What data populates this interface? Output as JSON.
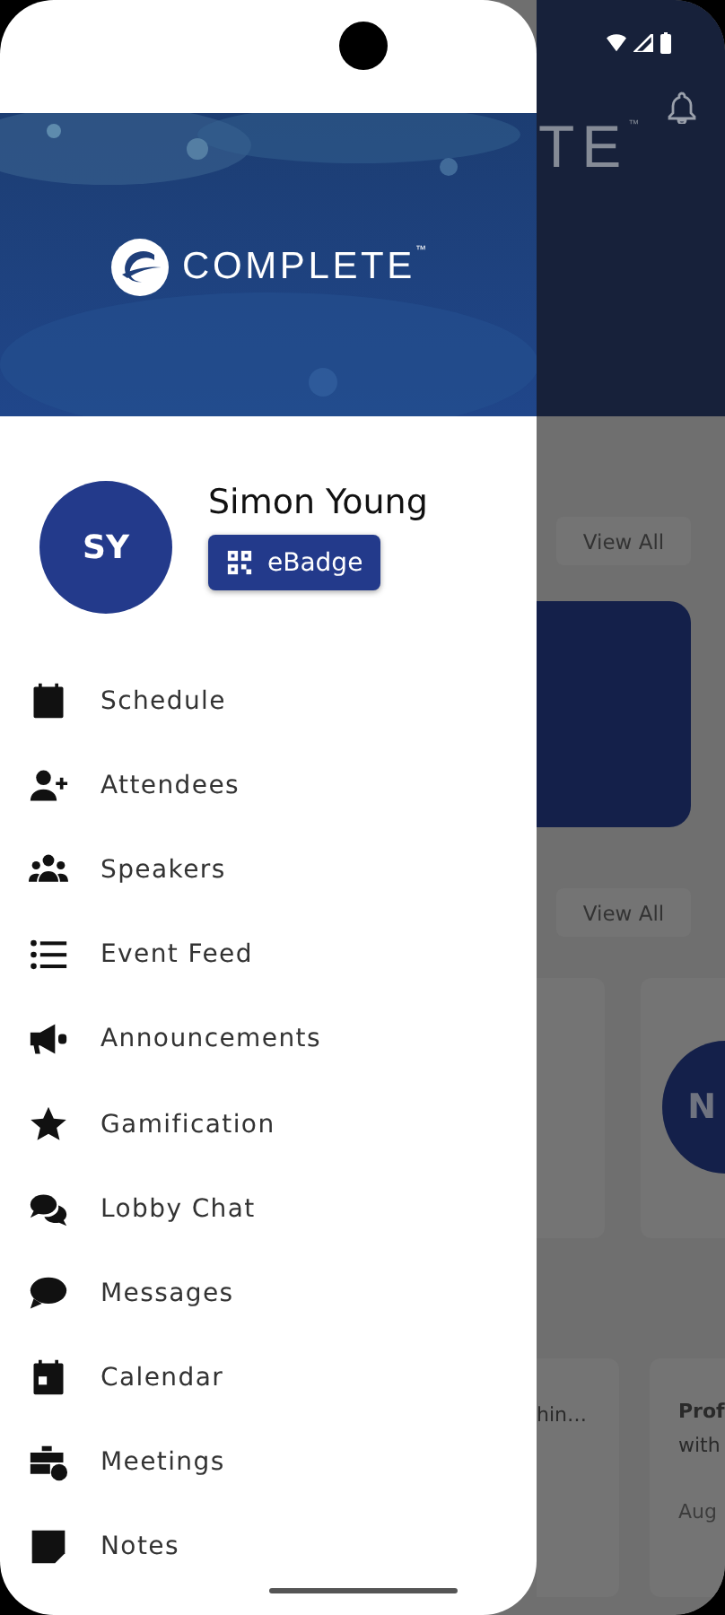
{
  "drawer": {
    "banner": {
      "logo_text": "COMPLETE",
      "trademark": "™"
    },
    "profile": {
      "initials": "SY",
      "name": "Simon Young",
      "badge_button": "eBadge"
    },
    "menu": [
      {
        "label": "Schedule"
      },
      {
        "label": "Attendees"
      },
      {
        "label": "Speakers"
      },
      {
        "label": "Event Feed"
      },
      {
        "label": "Announcements"
      },
      {
        "label": "Gamification"
      },
      {
        "label": "Lobby Chat"
      },
      {
        "label": "Messages"
      },
      {
        "label": "Calendar"
      },
      {
        "label": "Meetings"
      },
      {
        "label": "Notes"
      }
    ]
  },
  "background": {
    "header_logo_fragment": "TE",
    "trademark": "™",
    "view_all_buttons": [
      "View All",
      "View All"
    ],
    "avatar_initial": "N",
    "card_title_fragment": "hin…",
    "card_lines": [
      "Prof",
      "with",
      "Aug"
    ]
  }
}
